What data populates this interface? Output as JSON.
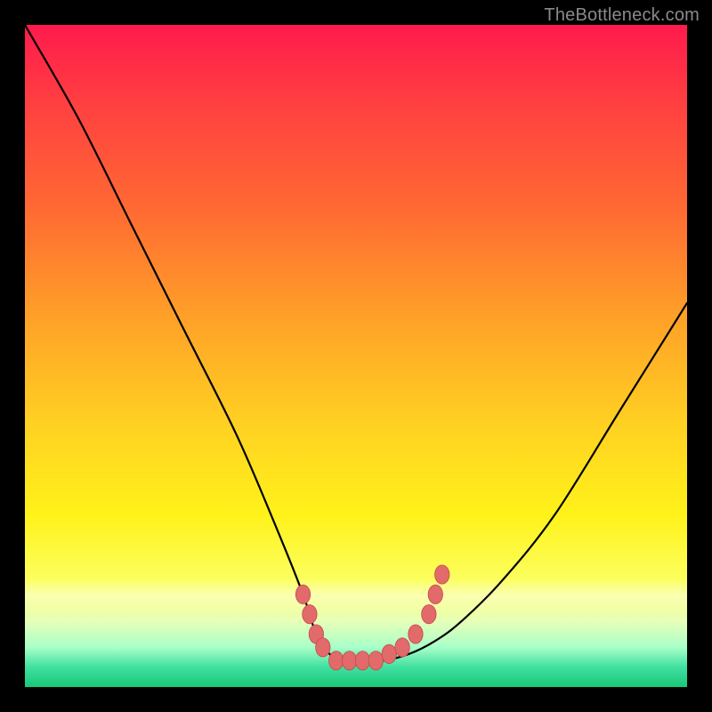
{
  "watermark": "TheBottleneck.com",
  "colors": {
    "frame": "#000000",
    "gradient_top": "#ff1a4d",
    "gradient_mid": "#ffe61a",
    "gradient_bottom": "#18c878",
    "curve_stroke": "#000000",
    "marker_fill": "#e26a6a",
    "marker_stroke": "#c24a4a"
  },
  "chart_data": {
    "type": "line",
    "title": "",
    "xlabel": "",
    "ylabel": "",
    "xlim": [
      0,
      100
    ],
    "ylim": [
      100,
      0
    ],
    "series": [
      {
        "name": "left-curve",
        "x": [
          0,
          8,
          16,
          24,
          32,
          38,
          42,
          44,
          46,
          48,
          50
        ],
        "y": [
          0,
          14,
          30,
          46,
          62,
          76,
          86,
          92,
          95,
          96,
          96
        ]
      },
      {
        "name": "right-curve",
        "x": [
          50,
          54,
          58,
          62,
          66,
          72,
          80,
          90,
          100
        ],
        "y": [
          96,
          96,
          95,
          93,
          90,
          84,
          74,
          58,
          42
        ]
      }
    ],
    "markers": {
      "name": "bottom-cluster",
      "points": [
        {
          "x": 42,
          "y": 86,
          "r": 1.1
        },
        {
          "x": 43,
          "y": 89,
          "r": 1.1
        },
        {
          "x": 44,
          "y": 92,
          "r": 1.1
        },
        {
          "x": 45,
          "y": 94,
          "r": 1.1
        },
        {
          "x": 47,
          "y": 96,
          "r": 1.1
        },
        {
          "x": 49,
          "y": 96,
          "r": 1.1
        },
        {
          "x": 51,
          "y": 96,
          "r": 1.1
        },
        {
          "x": 53,
          "y": 96,
          "r": 1.1
        },
        {
          "x": 55,
          "y": 95,
          "r": 1.1
        },
        {
          "x": 57,
          "y": 94,
          "r": 1.1
        },
        {
          "x": 59,
          "y": 92,
          "r": 1.1
        },
        {
          "x": 61,
          "y": 89,
          "r": 1.1
        },
        {
          "x": 62,
          "y": 86,
          "r": 1.1
        },
        {
          "x": 63,
          "y": 83,
          "r": 1.1
        }
      ]
    }
  }
}
